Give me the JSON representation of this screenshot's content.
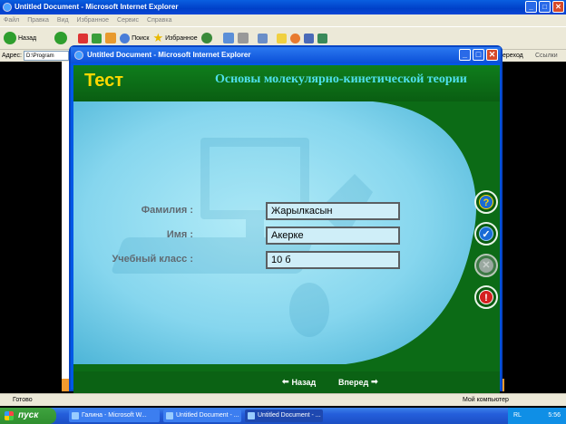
{
  "bg_window": {
    "title": "Untitled Document - Microsoft Internet Explorer",
    "menu": [
      "Файл",
      "Правка",
      "Вид",
      "Избранное",
      "Сервис",
      "Справка"
    ],
    "toolbar": {
      "back": "Назад",
      "search": "Поиск",
      "favorites": "Избранное"
    },
    "address_label": "Адрес:",
    "address_value": "D:\\Program",
    "links_label": "ереход",
    "links2_label": "Ссылки",
    "status_ready": "Готово",
    "status_zone": "Мой компьютер"
  },
  "taskbar": {
    "start": "пуск",
    "tasks": [
      "Галина - Microsoft W...",
      "Untitled Document - ...",
      "Untitled Document - ..."
    ],
    "lang": "RL",
    "clock": "5:56"
  },
  "popup": {
    "title": "Untitled Document - Microsoft Internet Explorer"
  },
  "app": {
    "logo": "Тест",
    "subtitle": "Основы молекулярно-кинетической теории",
    "form": {
      "surname_label": "Фамилия :",
      "surname_value": "Жарылкасын",
      "name_label": "Имя :",
      "name_value": "Акерке",
      "class_label": "Учебный класс :",
      "class_value": "10 б"
    },
    "nav": {
      "back": "Назад",
      "forward": "Вперед"
    },
    "side_buttons": [
      "help-icon",
      "check-icon",
      "cancel-icon",
      "exit-icon"
    ],
    "colors": {
      "header_green": "#0c6b16",
      "logo_yellow": "#ffd800",
      "subtitle_cyan": "#4fe0ec",
      "panel_blue": "#7fd3ec"
    }
  }
}
